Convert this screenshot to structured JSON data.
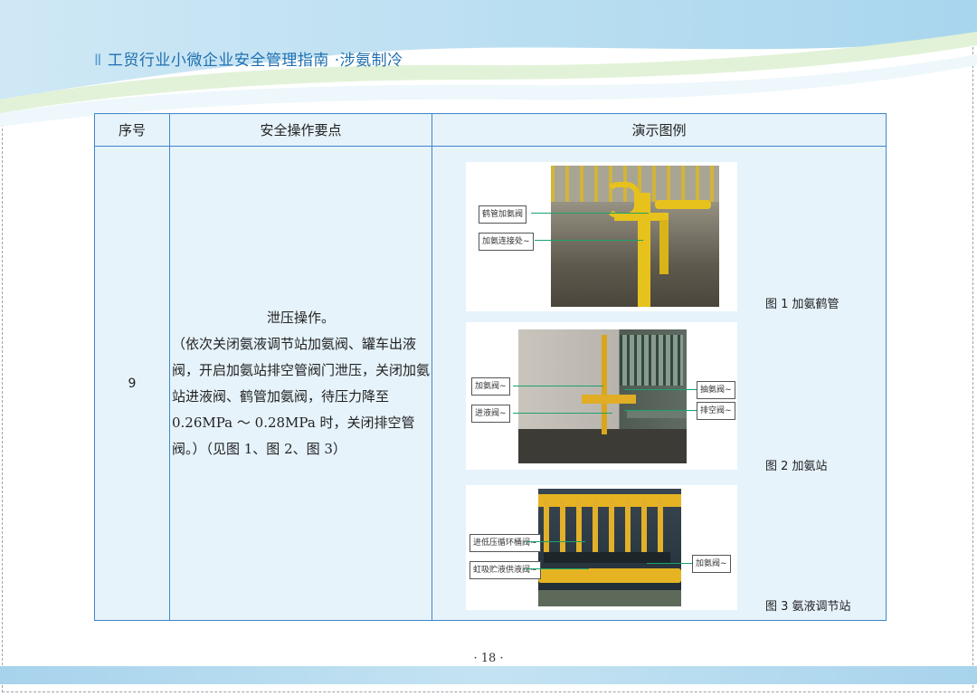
{
  "header": {
    "bar": "Ⅱ",
    "title": "工贸行业小微企业安全管理指南 ·涉氨制冷"
  },
  "table": {
    "columns": [
      "序号",
      "安全操作要点",
      "演示图例"
    ],
    "row": {
      "number": "9",
      "lead": "泄压操作。",
      "body": "（依次关闭氨液调节站加氨阀、罐车出液阀，开启加氨站排空管阀门泄压，关闭加氨站进液阀、鹤管加氨阀，待压力降至 0.26MPa ～ 0.28MPa 时，关闭排空管阀。）（见图 1、图 2、图 3）"
    }
  },
  "figures": [
    {
      "caption": "图 1 加氨鹤管",
      "callouts": [
        "鹤管加氨阀",
        "加氨连接处~"
      ]
    },
    {
      "caption": "图 2 加氨站",
      "callouts": [
        "加氨阀~",
        "进液阀~",
        "抽氨阀~",
        "排空阀~"
      ]
    },
    {
      "caption": "图 3 氨液调节站",
      "callouts": [
        "进低压循环桶阀~",
        "虹吸贮液供液阀~",
        "加氨阀~"
      ]
    }
  ],
  "footer": {
    "page": "· 18 ·"
  }
}
